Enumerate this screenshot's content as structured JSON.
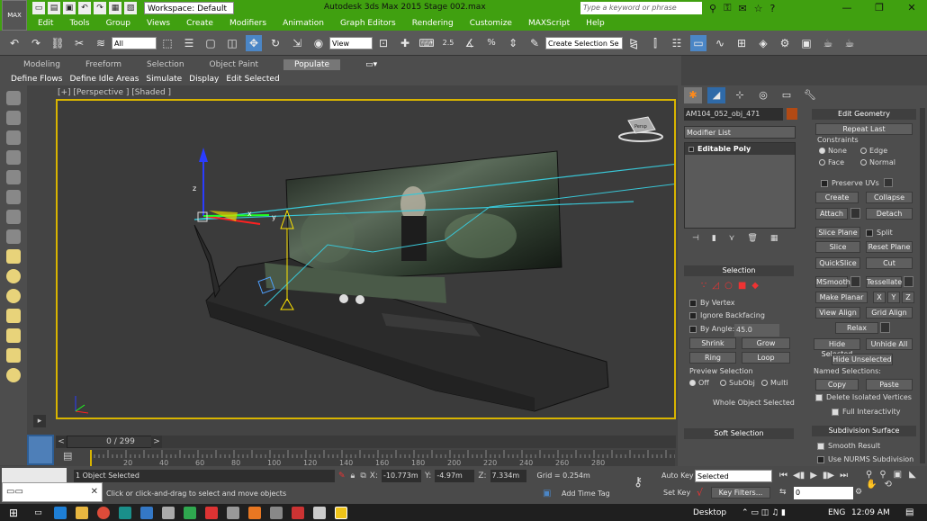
{
  "title_bar": {
    "workspace": "Workspace: Default",
    "app_title": "Autodesk 3ds Max  2015    Stage 002.max",
    "search_placeholder": "Type a keyword or phrase",
    "logo": "MAX"
  },
  "menu": [
    "Edit",
    "Tools",
    "Group",
    "Views",
    "Create",
    "Modifiers",
    "Animation",
    "Graph Editors",
    "Rendering",
    "Customize",
    "MAXScript",
    "Help"
  ],
  "toolbar": {
    "filter": "All",
    "ref_coord": "View",
    "snaps": [
      "2.5",
      "%"
    ],
    "selection_set": "Create Selection Se"
  },
  "ribbon": {
    "tabs": [
      "Modeling",
      "Freeform",
      "Selection",
      "Object Paint",
      "Populate"
    ],
    "active_tab": "Populate",
    "sub": [
      "Define Flows",
      "Define Idle Areas",
      "Simulate",
      "Display",
      "Edit Selected"
    ]
  },
  "viewport": {
    "label": "[+] [Perspective ] [Shaded ]",
    "axes": {
      "x": "x",
      "y": "y",
      "z": "z"
    },
    "gizmo_label": "Persp"
  },
  "time": {
    "slider": "0 / 299",
    "ticks": [
      "20",
      "40",
      "60",
      "80",
      "100",
      "120",
      "140",
      "160",
      "180",
      "200",
      "220",
      "240",
      "260",
      "280"
    ]
  },
  "status": {
    "selected": "1 Object Selected",
    "prompt": "Click or click-and-drag to select and move objects",
    "x": "-10.773m",
    "y": "-4.97m",
    "z": "7.334m",
    "grid": "Grid = 0.254m",
    "add_time_tag": "Add Time Tag",
    "auto_key": "Auto Key",
    "set_key": "Set Key",
    "selected_combo": "Selected",
    "key_filters": "Key Filters...",
    "frame": "0"
  },
  "panel": {
    "object_name": "AM104_052_obj_471",
    "object_color": "#b34a14",
    "modifier_list": "Modifier List",
    "stack_item": "Editable Poly",
    "selection": {
      "title": "Selection",
      "by_vertex": "By Vertex",
      "ignore_backfacing": "Ignore Backfacing",
      "by_angle": "By Angle:",
      "angle": "45.0",
      "shrink": "Shrink",
      "grow": "Grow",
      "ring": "Ring",
      "loop": "Loop",
      "preview": "Preview Selection",
      "off": "Off",
      "subobj": "SubObj",
      "multi": "Multi",
      "whole": "Whole Object Selected"
    },
    "soft_selection": "Soft Selection",
    "edit_geometry": {
      "title": "Edit Geometry",
      "repeat_last": "Repeat Last",
      "constraints": "Constraints",
      "none": "None",
      "edge": "Edge",
      "face": "Face",
      "normal": "Normal",
      "preserve_uvs": "Preserve UVs",
      "create": "Create",
      "collapse": "Collapse",
      "attach": "Attach",
      "detach": "Detach",
      "slice_plane": "Slice Plane",
      "split": "Split",
      "slice": "Slice",
      "reset_plane": "Reset Plane",
      "quickslice": "QuickSlice",
      "cut": "Cut",
      "msmooth": "MSmooth",
      "tessellate": "Tessellate",
      "make_planar": "Make Planar",
      "x": "X",
      "y": "Y",
      "z": "Z",
      "view_align": "View Align",
      "grid_align": "Grid Align",
      "relax": "Relax",
      "hide_selected": "Hide Selected",
      "unhide_all": "Unhide All",
      "hide_unselected": "Hide Unselected",
      "named_selections": "Named Selections:",
      "copy": "Copy",
      "paste": "Paste",
      "delete_isolated": "Delete Isolated Vertices",
      "full_interactivity": "Full Interactivity"
    },
    "subdivision": {
      "title": "Subdivision Surface",
      "smooth_result": "Smooth Result",
      "use_nurms": "Use NURMS Subdivision"
    }
  },
  "taskbar": {
    "desktop": "Desktop",
    "lang": "ENG",
    "clock": "12:09 AM"
  }
}
